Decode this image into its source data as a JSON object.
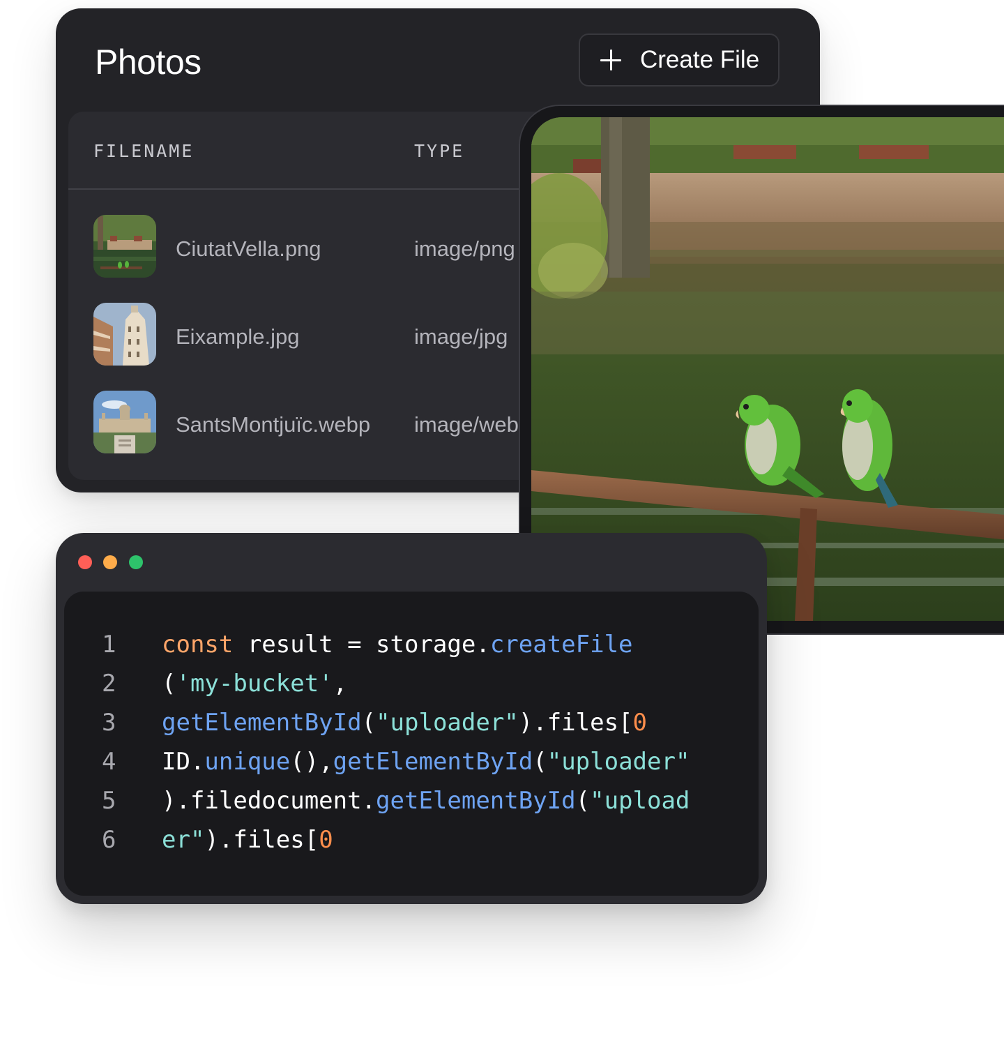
{
  "photos": {
    "title": "Photos",
    "create_button_label": "Create File",
    "columns": {
      "filename": "FILENAME",
      "type": "TYPE"
    },
    "files": [
      {
        "name": "CiutatVella.png",
        "type": "image/png"
      },
      {
        "name": "Eixample.jpg",
        "type": "image/jpg"
      },
      {
        "name": "SantsMontjuïc.webp",
        "type": "image/webp"
      }
    ]
  },
  "editor": {
    "window_controls": [
      "close",
      "minimize",
      "maximize"
    ],
    "lines": [
      {
        "number": "1",
        "tokens": [
          {
            "t": "const",
            "k": "kw"
          },
          {
            "t": " result = storage.",
            "k": "plain"
          },
          {
            "t": "createFile",
            "k": "fn"
          }
        ]
      },
      {
        "number": "2",
        "tokens": [
          {
            "t": "(",
            "k": "plain"
          },
          {
            "t": "'my-bucket'",
            "k": "str"
          },
          {
            "t": ",",
            "k": "plain"
          }
        ]
      },
      {
        "number": "3",
        "tokens": [
          {
            "t": "getElementById",
            "k": "fn"
          },
          {
            "t": "(",
            "k": "plain"
          },
          {
            "t": "\"uploader\"",
            "k": "str"
          },
          {
            "t": ").files[",
            "k": "plain"
          },
          {
            "t": "0",
            "k": "num"
          }
        ]
      },
      {
        "number": "4",
        "tokens": [
          {
            "t": "ID.",
            "k": "plain"
          },
          {
            "t": "unique",
            "k": "fn"
          },
          {
            "t": "(),",
            "k": "plain"
          },
          {
            "t": "getElementById",
            "k": "fn"
          },
          {
            "t": "(",
            "k": "plain"
          },
          {
            "t": "\"uploader\"",
            "k": "str"
          }
        ]
      },
      {
        "number": "5",
        "tokens": [
          {
            "t": ").filedocument.",
            "k": "plain"
          },
          {
            "t": "getElementById",
            "k": "fn"
          },
          {
            "t": "(",
            "k": "plain"
          },
          {
            "t": "\"upload",
            "k": "str"
          }
        ]
      },
      {
        "number": "6",
        "tokens": [
          {
            "t": "er\"",
            "k": "str"
          },
          {
            "t": ").files[",
            "k": "plain"
          },
          {
            "t": "0",
            "k": "num"
          }
        ]
      }
    ]
  },
  "colors": {
    "panel": "#232327",
    "table": "#2b2b30",
    "code_bg": "#19191c",
    "keyword": "#fea569",
    "function": "#6ea3f2",
    "string": "#8ce0d8",
    "number": "#fe8e4c"
  }
}
